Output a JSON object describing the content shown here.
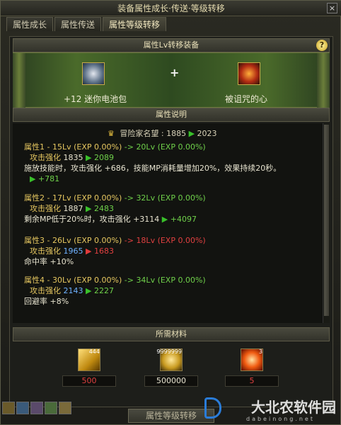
{
  "window": {
    "title": "装备属性成长·传送·等级转移",
    "close_glyph": "×"
  },
  "tabs": [
    {
      "label": "属性成长"
    },
    {
      "label": "属性传送"
    },
    {
      "label": "属性等级转移"
    }
  ],
  "transfer_section": {
    "header": "属性Lv转移装备",
    "left_item": "+12 迷你电池包",
    "plus_glyph": "+",
    "right_item": "被诅咒的心"
  },
  "description_section": {
    "header": "属性说明",
    "fame": {
      "label": "冒险家名望 :",
      "from": "1885",
      "to": "2023"
    },
    "properties": [
      {
        "title": "属性1 - 15Lv (EXP 0.00%)",
        "arrow": "->",
        "result": "20Lv (EXP 0.00%)",
        "stat_label": "攻击强化",
        "stat_from": "1835",
        "stat_to": "2089",
        "extra_lines": [
          "施放技能时，攻击强化 +686，技能MP消耗量增加20%，效果持续20秒。",
          "+781"
        ]
      },
      {
        "title": "属性2 - 17Lv (EXP 0.00%)",
        "arrow": "->",
        "result": "32Lv (EXP 0.00%)",
        "stat_label": "攻击强化",
        "stat_from": "1887",
        "stat_to": "2483",
        "extra_lines": [
          "剩余MP低于20%时，攻击强化 +3114",
          "+4097"
        ]
      },
      {
        "title": "属性3 - 26Lv (EXP 0.00%)",
        "arrow": "->",
        "result": "18Lv (EXP 0.00%)",
        "stat_label": "攻击强化",
        "stat_from": "1965",
        "stat_to": "1683",
        "extra_lines": [
          "命中率 +10%"
        ]
      },
      {
        "title": "属性4 - 30Lv (EXP 0.00%)",
        "arrow": "->",
        "result": "34Lv (EXP 0.00%)",
        "stat_label": "攻击强化",
        "stat_from": "2143",
        "stat_to": "2227",
        "extra_lines": [
          "回避率 +8%"
        ]
      }
    ]
  },
  "materials_section": {
    "header": "所需材料",
    "items": [
      {
        "icon": "gold-bars-icon",
        "badge": "444",
        "count": "500"
      },
      {
        "icon": "gold-coins-icon",
        "badge": "9999999",
        "count": "500000"
      },
      {
        "icon": "flame-orb-icon",
        "badge": "3",
        "count": "5"
      }
    ]
  },
  "bottom_button": "属性等级转移",
  "watermark": {
    "text": "大北农软件园",
    "sub": "dabeinong.net"
  },
  "colors": {
    "increase": "#39c02a",
    "decrease": "#e03a3a",
    "gold_text": "#e6c760",
    "blue_text": "#6fb2ff"
  }
}
